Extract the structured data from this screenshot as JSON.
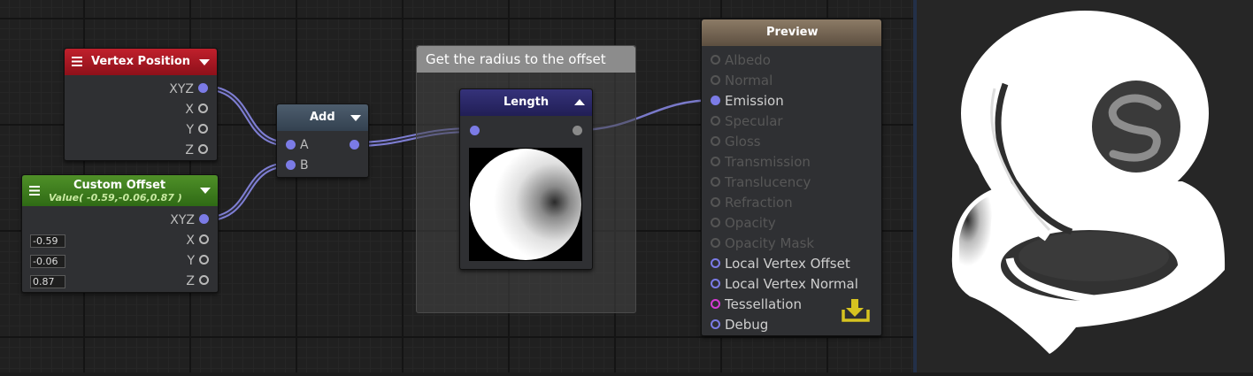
{
  "vertex_position": {
    "title": "Vertex Position",
    "ports": [
      "XYZ",
      "X",
      "Y",
      "Z"
    ]
  },
  "custom_offset": {
    "title": "Custom Offset",
    "subtitle": "Value( -0.59,-0.06,0.87 )",
    "ports": [
      "XYZ",
      "X",
      "Y",
      "Z"
    ],
    "values": [
      "-0.59",
      "-0.06",
      "0.87"
    ]
  },
  "add_node": {
    "title": "Add",
    "inputs": [
      "A",
      "B"
    ]
  },
  "comment": {
    "title": "Get the radius to the offset"
  },
  "length_node": {
    "title": "Length"
  },
  "output_node": {
    "title": "Preview",
    "ports": [
      {
        "label": "Albedo",
        "state": "inactive"
      },
      {
        "label": "Normal",
        "state": "inactive"
      },
      {
        "label": "Emission",
        "state": "connected"
      },
      {
        "label": "Specular",
        "state": "inactive"
      },
      {
        "label": "Gloss",
        "state": "inactive"
      },
      {
        "label": "Transmission",
        "state": "inactive"
      },
      {
        "label": "Translucency",
        "state": "inactive"
      },
      {
        "label": "Refraction",
        "state": "inactive"
      },
      {
        "label": "Opacity",
        "state": "inactive"
      },
      {
        "label": "Opacity Mask",
        "state": "inactive"
      },
      {
        "label": "Local Vertex Offset",
        "state": "active"
      },
      {
        "label": "Local Vertex Normal",
        "state": "active"
      },
      {
        "label": "Tessellation",
        "state": "special"
      },
      {
        "label": "Debug",
        "state": "active"
      }
    ]
  },
  "icons": {
    "menu": "menu-icon",
    "collapse": "chevron-down-icon",
    "expand": "chevron-up-icon",
    "export": "download-icon",
    "logo": "shaderforge-logo"
  },
  "colors": {
    "port": "#7b7be6",
    "vertex_header": "#a5141e",
    "offset_header": "#3f7e1f",
    "add_header": "#3e4c5a",
    "length_header": "#2a2858",
    "preview_header": "#7a6a56",
    "tessellation": "#d43bd4",
    "export_icon": "#d6c320"
  }
}
